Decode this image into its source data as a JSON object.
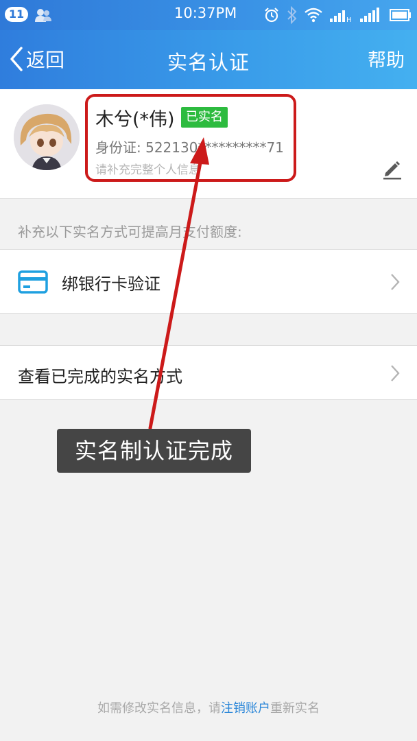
{
  "status_bar": {
    "notification_count": "11",
    "time": "10:37PM"
  },
  "nav": {
    "back_label": "返回",
    "title": "实名认证",
    "help_label": "帮助"
  },
  "profile": {
    "name": "木兮(*伟)",
    "verified_badge": "已实名",
    "id_number": "身份证: 522130**********71",
    "hint": "请补充完整个人信息"
  },
  "section_header": "补充以下实名方式可提高月支付额度:",
  "list": {
    "bank_card_label": "绑银行卡验证",
    "view_methods_label": "查看已完成的实名方式"
  },
  "annotation": {
    "toast_text": "实名制认证完成"
  },
  "footer": {
    "prefix": "如需修改实名信息，请",
    "link": "注销账户",
    "suffix": "重新实名"
  },
  "colors": {
    "nav_gradient_start": "#2f7ddd",
    "nav_gradient_end": "#44b0f0",
    "verified_green": "#2dbb3f",
    "annotation_red": "#cc1a1a",
    "link_blue": "#2c87d8",
    "bank_icon_blue": "#1fa0e0"
  },
  "icons": {
    "back": "chevron-left-icon",
    "edit": "pencil-icon",
    "bank_card": "credit-card-icon",
    "row_arrow": "chevron-right-icon"
  }
}
